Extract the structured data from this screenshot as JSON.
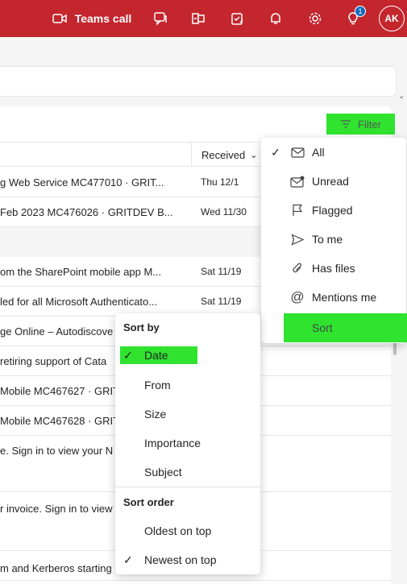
{
  "topbar": {
    "teams_call_label": "Teams call",
    "notification_badge": "1",
    "avatar_initials": "AK",
    "bg_color": "#c4262e"
  },
  "list": {
    "filter_label": "Filter",
    "received_header": "Received",
    "rows": [
      {
        "subject": "g Web Service MC477010 · GRIT...",
        "date": "Thu 12/1"
      },
      {
        "subject": "Feb 2023 MC476026 · GRITDEV B...",
        "date": "Wed 11/30"
      },
      {
        "subject": "om the SharePoint mobile app M...",
        "date": "Sat 11/19"
      },
      {
        "subject": "led for all Microsoft Authenticato...",
        "date": "Sat 11/19"
      },
      {
        "subject": "ge Online – Autodiscove",
        "date": ""
      },
      {
        "subject": "retiring support of Cata",
        "date": ""
      },
      {
        "subject": "Mobile MC467627 · GRIT",
        "date": ""
      },
      {
        "subject": "Mobile MC467628 · GRIT",
        "date": ""
      },
      {
        "subject": "e. Sign in to view your N",
        "date": ""
      },
      {
        "subject": "r invoice. Sign in to view",
        "date": ""
      },
      {
        "subject": "m and Kerberos starting",
        "date": ""
      }
    ]
  },
  "filter_menu": {
    "items": [
      {
        "label": "All",
        "icon": "envelope-icon",
        "checked": true
      },
      {
        "label": "Unread",
        "icon": "unread-envelope-icon",
        "checked": false
      },
      {
        "label": "Flagged",
        "icon": "flag-icon",
        "checked": false
      },
      {
        "label": "To me",
        "icon": "send-icon",
        "checked": false
      },
      {
        "label": "Has files",
        "icon": "paperclip-icon",
        "checked": false
      },
      {
        "label": "Mentions me",
        "icon": "at-icon",
        "checked": false
      }
    ],
    "sort_label": "Sort"
  },
  "sort_menu": {
    "sort_by_label": "Sort by",
    "sort_by_options": [
      {
        "label": "Date",
        "checked": true
      },
      {
        "label": "From",
        "checked": false
      },
      {
        "label": "Size",
        "checked": false
      },
      {
        "label": "Importance",
        "checked": false
      },
      {
        "label": "Subject",
        "checked": false
      }
    ],
    "sort_order_label": "Sort order",
    "order_options": [
      {
        "label": "Oldest on top",
        "checked": false
      },
      {
        "label": "Newest on top",
        "checked": true
      }
    ]
  },
  "highlight_color": "#2fe32f"
}
